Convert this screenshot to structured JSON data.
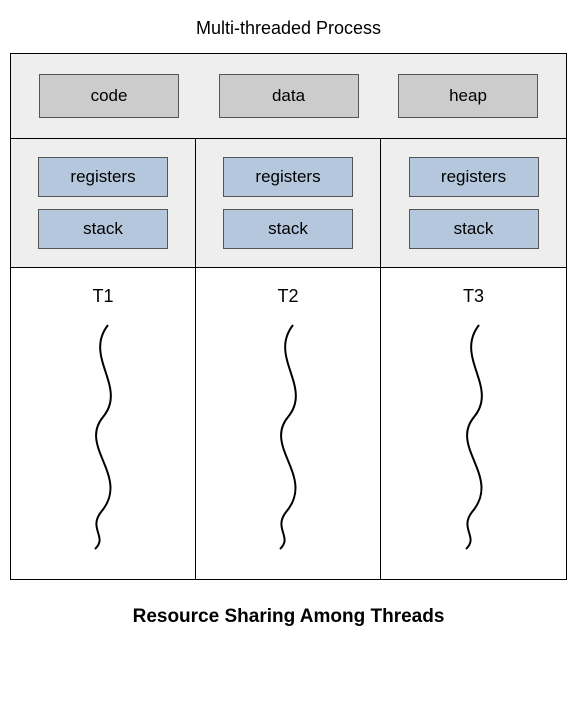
{
  "title": "Multi-threaded Process",
  "shared": {
    "code": "code",
    "data": "data",
    "heap": "heap"
  },
  "private": {
    "registers": "registers",
    "stack": "stack"
  },
  "threads": {
    "t1": "T1",
    "t2": "T2",
    "t3": "T3"
  },
  "caption": "Resource Sharing Among Threads"
}
